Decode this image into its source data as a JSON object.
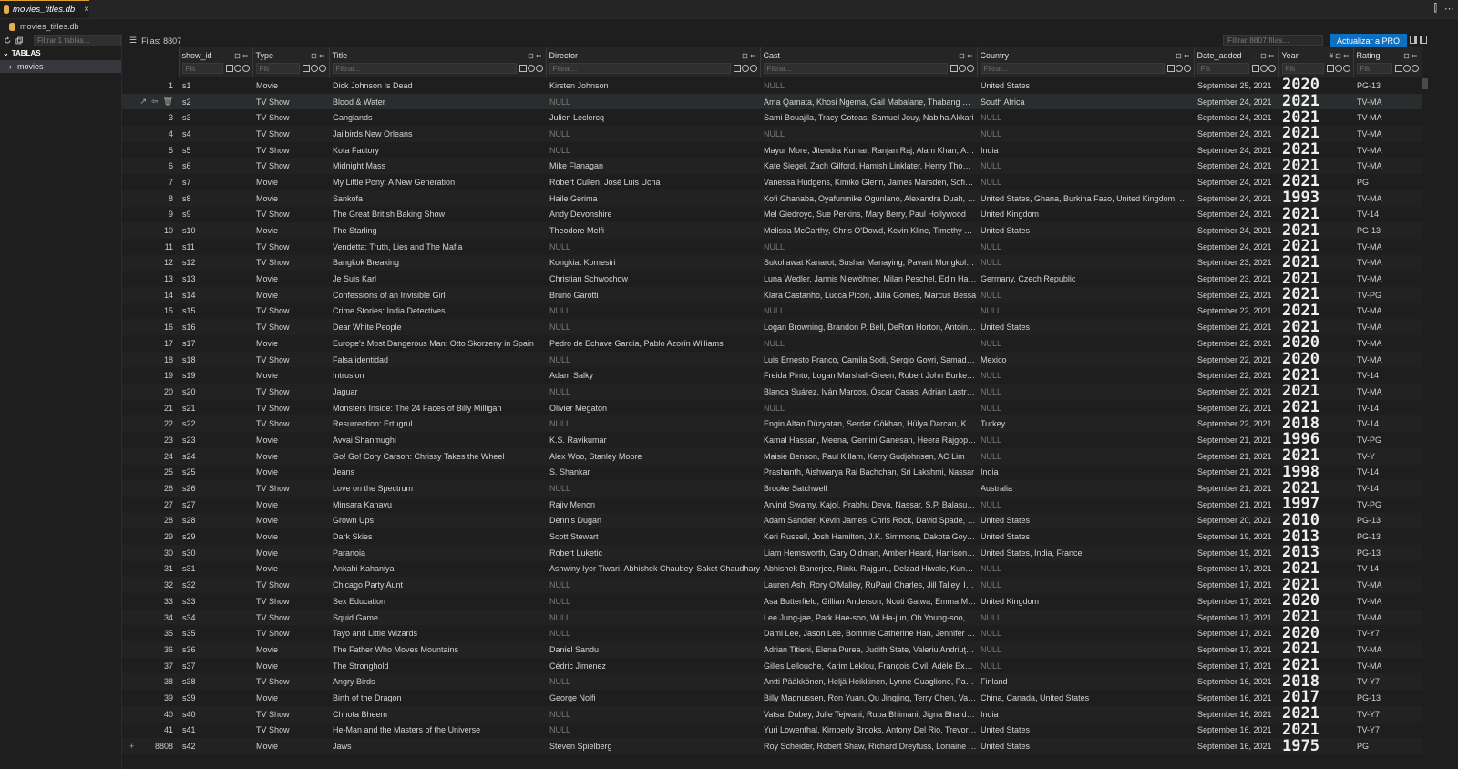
{
  "tab": {
    "title": "movies_titles.db",
    "close": "×",
    "right_icons": [
      "⫿",
      "⋯"
    ]
  },
  "breadcrumb": {
    "file": "movies_titles.db"
  },
  "sidebar": {
    "filter_placeholder": "Filtrar 1 tablas...",
    "section": "TABLAS",
    "item": "movies"
  },
  "toolbar": {
    "rows_label": "Filas: 8807",
    "filter_placeholder": "Filtrar 8807 filas...",
    "pro_button": "Actualizar a PRO"
  },
  "columns": [
    {
      "key": "show_id",
      "label": "show_id",
      "filter": "Filt"
    },
    {
      "key": "type",
      "label": "Type",
      "filter": "Filt"
    },
    {
      "key": "title",
      "label": "Title",
      "filter": "Filtrar..."
    },
    {
      "key": "director",
      "label": "Director",
      "filter": "Filtrar..."
    },
    {
      "key": "cast",
      "label": "Cast",
      "filter": "Filtrar..."
    },
    {
      "key": "country",
      "label": "Country",
      "filter": "Filtrar..."
    },
    {
      "key": "date_added",
      "label": "Date_added",
      "filter": "Filt"
    },
    {
      "key": "year",
      "label": "Year",
      "filter": "Filt",
      "type_glyph": "#"
    },
    {
      "key": "rating",
      "label": "Rating",
      "filter": "Filt"
    }
  ],
  "rows": [
    {
      "n": "1",
      "show_id": "s1",
      "type": "Movie",
      "title": "Dick Johnson Is Dead",
      "director": "Kirsten Johnson",
      "cast": "NULL",
      "country": "United States",
      "date_added": "September 25, 2021",
      "year": "2020",
      "rating": "PG-13"
    },
    {
      "n": "",
      "show_id": "s2",
      "type": "TV Show",
      "title": "Blood & Water",
      "director": "NULL",
      "cast": "Ama Qamata, Khosi Ngema, Gail Mabalane, Thabang Molaba, Dillon Windvogel",
      "country": "South Africa",
      "date_added": "September 24, 2021",
      "year": "2021",
      "rating": "TV-MA"
    },
    {
      "n": "3",
      "show_id": "s3",
      "type": "TV Show",
      "title": "Ganglands",
      "director": "Julien Leclercq",
      "cast": "Sami Bouajila, Tracy Gotoas, Samuel Jouy, Nabiha Akkari",
      "country": "NULL",
      "date_added": "September 24, 2021",
      "year": "2021",
      "rating": "TV-MA"
    },
    {
      "n": "4",
      "show_id": "s4",
      "type": "TV Show",
      "title": "Jailbirds New Orleans",
      "director": "NULL",
      "cast": "NULL",
      "country": "NULL",
      "date_added": "September 24, 2021",
      "year": "2021",
      "rating": "TV-MA"
    },
    {
      "n": "5",
      "show_id": "s5",
      "type": "TV Show",
      "title": "Kota Factory",
      "director": "NULL",
      "cast": "Mayur More, Jitendra Kumar, Ranjan Raj, Alam Khan, Ahsaas Channa",
      "country": "India",
      "date_added": "September 24, 2021",
      "year": "2021",
      "rating": "TV-MA"
    },
    {
      "n": "6",
      "show_id": "s6",
      "type": "TV Show",
      "title": "Midnight Mass",
      "director": "Mike Flanagan",
      "cast": "Kate Siegel, Zach Gilford, Hamish Linklater, Henry Thomas",
      "country": "NULL",
      "date_added": "September 24, 2021",
      "year": "2021",
      "rating": "TV-MA"
    },
    {
      "n": "7",
      "show_id": "s7",
      "type": "Movie",
      "title": "My Little Pony: A New Generation",
      "director": "Robert Cullen, José Luis Ucha",
      "cast": "Vanessa Hudgens, Kimiko Glenn, James Marsden, Sofia Carson",
      "country": "NULL",
      "date_added": "September 24, 2021",
      "year": "2021",
      "rating": "PG"
    },
    {
      "n": "8",
      "show_id": "s8",
      "type": "Movie",
      "title": "Sankofa",
      "director": "Haile Gerima",
      "cast": "Kofi Ghanaba, Oyafunmike Ogunlano, Alexandra Duah, Nick Medley",
      "country": "United States, Ghana, Burkina Faso, United Kingdom, Germany",
      "date_added": "September 24, 2021",
      "year": "1993",
      "rating": "TV-MA"
    },
    {
      "n": "9",
      "show_id": "s9",
      "type": "TV Show",
      "title": "The Great British Baking Show",
      "director": "Andy Devonshire",
      "cast": "Mel Giedroyc, Sue Perkins, Mary Berry, Paul Hollywood",
      "country": "United Kingdom",
      "date_added": "September 24, 2021",
      "year": "2021",
      "rating": "TV-14"
    },
    {
      "n": "10",
      "show_id": "s10",
      "type": "Movie",
      "title": "The Starling",
      "director": "Theodore Melfi",
      "cast": "Melissa McCarthy, Chris O'Dowd, Kevin Kline, Timothy Olyphant",
      "country": "United States",
      "date_added": "September 24, 2021",
      "year": "2021",
      "rating": "PG-13"
    },
    {
      "n": "11",
      "show_id": "s11",
      "type": "TV Show",
      "title": "Vendetta: Truth, Lies and The Mafia",
      "director": "NULL",
      "cast": "NULL",
      "country": "NULL",
      "date_added": "September 24, 2021",
      "year": "2021",
      "rating": "TV-MA"
    },
    {
      "n": "12",
      "show_id": "s12",
      "type": "TV Show",
      "title": "Bangkok Breaking",
      "director": "Kongkiat Komesiri",
      "cast": "Sukollawat Kanarot, Sushar Manaying, Pavarit Mongkolpisit",
      "country": "NULL",
      "date_added": "September 23, 2021",
      "year": "2021",
      "rating": "TV-MA"
    },
    {
      "n": "13",
      "show_id": "s13",
      "type": "Movie",
      "title": "Je Suis Karl",
      "director": "Christian Schwochow",
      "cast": "Luna Wedler, Jannis Niewöhner, Milan Peschel, Edin Hasanović",
      "country": "Germany, Czech Republic",
      "date_added": "September 23, 2021",
      "year": "2021",
      "rating": "TV-MA"
    },
    {
      "n": "14",
      "show_id": "s14",
      "type": "Movie",
      "title": "Confessions of an Invisible Girl",
      "director": "Bruno Garotti",
      "cast": "Klara Castanho, Lucca Picon, Júlia Gomes, Marcus Bessa",
      "country": "NULL",
      "date_added": "September 22, 2021",
      "year": "2021",
      "rating": "TV-PG"
    },
    {
      "n": "15",
      "show_id": "s15",
      "type": "TV Show",
      "title": "Crime Stories: India Detectives",
      "director": "NULL",
      "cast": "NULL",
      "country": "NULL",
      "date_added": "September 22, 2021",
      "year": "2021",
      "rating": "TV-MA"
    },
    {
      "n": "16",
      "show_id": "s16",
      "type": "TV Show",
      "title": "Dear White People",
      "director": "NULL",
      "cast": "Logan Browning, Brandon P. Bell, DeRon Horton, Antoinette Robertson",
      "country": "United States",
      "date_added": "September 22, 2021",
      "year": "2021",
      "rating": "TV-MA"
    },
    {
      "n": "17",
      "show_id": "s17",
      "type": "Movie",
      "title": "Europe's Most Dangerous Man: Otto Skorzeny in Spain",
      "director": "Pedro de Echave García, Pablo Azorín Williams",
      "cast": "NULL",
      "country": "NULL",
      "date_added": "September 22, 2021",
      "year": "2020",
      "rating": "TV-MA"
    },
    {
      "n": "18",
      "show_id": "s18",
      "type": "TV Show",
      "title": "Falsa identidad",
      "director": "NULL",
      "cast": "Luis Ernesto Franco, Camila Sodi, Sergio Goyri, Samadhi Zendejas",
      "country": "Mexico",
      "date_added": "September 22, 2021",
      "year": "2020",
      "rating": "TV-MA"
    },
    {
      "n": "19",
      "show_id": "s19",
      "type": "Movie",
      "title": "Intrusion",
      "director": "Adam Salky",
      "cast": "Freida Pinto, Logan Marshall-Green, Robert John Burke, Megan Elisabeth Kelly",
      "country": "NULL",
      "date_added": "September 22, 2021",
      "year": "2021",
      "rating": "TV-14"
    },
    {
      "n": "20",
      "show_id": "s20",
      "type": "TV Show",
      "title": "Jaguar",
      "director": "NULL",
      "cast": "Blanca Suárez, Iván Marcos, Óscar Casas, Adrián Lastra, Francesc Garrido",
      "country": "NULL",
      "date_added": "September 22, 2021",
      "year": "2021",
      "rating": "TV-MA"
    },
    {
      "n": "21",
      "show_id": "s21",
      "type": "TV Show",
      "title": "Monsters Inside: The 24 Faces of Billy Milligan",
      "director": "Olivier Megaton",
      "cast": "NULL",
      "country": "NULL",
      "date_added": "September 22, 2021",
      "year": "2021",
      "rating": "TV-14"
    },
    {
      "n": "22",
      "show_id": "s22",
      "type": "TV Show",
      "title": "Resurrection: Ertugrul",
      "director": "NULL",
      "cast": "Engin Altan Düzyatan, Serdar Gökhan, Hülya Darcan, Kaan Taşaner",
      "country": "Turkey",
      "date_added": "September 22, 2021",
      "year": "2018",
      "rating": "TV-14"
    },
    {
      "n": "23",
      "show_id": "s23",
      "type": "Movie",
      "title": "Avvai Shanmughi",
      "director": "K.S. Ravikumar",
      "cast": "Kamal Hassan, Meena, Gemini Ganesan, Heera Rajgopal, Nassar",
      "country": "NULL",
      "date_added": "September 21, 2021",
      "year": "1996",
      "rating": "TV-PG"
    },
    {
      "n": "24",
      "show_id": "s24",
      "type": "Movie",
      "title": "Go! Go! Cory Carson: Chrissy Takes the Wheel",
      "director": "Alex Woo, Stanley Moore",
      "cast": "Maisie Benson, Paul Killam, Kerry Gudjohnsen, AC Lim",
      "country": "NULL",
      "date_added": "September 21, 2021",
      "year": "2021",
      "rating": "TV-Y"
    },
    {
      "n": "25",
      "show_id": "s25",
      "type": "Movie",
      "title": "Jeans",
      "director": "S. Shankar",
      "cast": "Prashanth, Aishwarya Rai Bachchan, Sri Lakshmi, Nassar",
      "country": "India",
      "date_added": "September 21, 2021",
      "year": "1998",
      "rating": "TV-14"
    },
    {
      "n": "26",
      "show_id": "s26",
      "type": "TV Show",
      "title": "Love on the Spectrum",
      "director": "NULL",
      "cast": "Brooke Satchwell",
      "country": "Australia",
      "date_added": "September 21, 2021",
      "year": "2021",
      "rating": "TV-14"
    },
    {
      "n": "27",
      "show_id": "s27",
      "type": "Movie",
      "title": "Minsara Kanavu",
      "director": "Rajiv Menon",
      "cast": "Arvind Swamy, Kajol, Prabhu Deva, Nassar, S.P. Balasubrahmanyam",
      "country": "NULL",
      "date_added": "September 21, 2021",
      "year": "1997",
      "rating": "TV-PG"
    },
    {
      "n": "28",
      "show_id": "s28",
      "type": "Movie",
      "title": "Grown Ups",
      "director": "Dennis Dugan",
      "cast": "Adam Sandler, Kevin James, Chris Rock, David Spade, Rob Schneider",
      "country": "United States",
      "date_added": "September 20, 2021",
      "year": "2010",
      "rating": "PG-13"
    },
    {
      "n": "29",
      "show_id": "s29",
      "type": "Movie",
      "title": "Dark Skies",
      "director": "Scott Stewart",
      "cast": "Keri Russell, Josh Hamilton, J.K. Simmons, Dakota Goyo, Kadan Rockett",
      "country": "United States",
      "date_added": "September 19, 2021",
      "year": "2013",
      "rating": "PG-13"
    },
    {
      "n": "30",
      "show_id": "s30",
      "type": "Movie",
      "title": "Paranoia",
      "director": "Robert Luketic",
      "cast": "Liam Hemsworth, Gary Oldman, Amber Heard, Harrison Ford",
      "country": "United States, India, France",
      "date_added": "September 19, 2021",
      "year": "2013",
      "rating": "PG-13"
    },
    {
      "n": "31",
      "show_id": "s31",
      "type": "Movie",
      "title": "Ankahi Kahaniya",
      "director": "Ashwiny Iyer Tiwari, Abhishek Chaubey, Saket Chaudhary",
      "cast": "Abhishek Banerjee, Rinku Rajguru, Delzad Hiwale, Kunal Kapoor",
      "country": "NULL",
      "date_added": "September 17, 2021",
      "year": "2021",
      "rating": "TV-14"
    },
    {
      "n": "32",
      "show_id": "s32",
      "type": "TV Show",
      "title": "Chicago Party Aunt",
      "director": "NULL",
      "cast": "Lauren Ash, Rory O'Malley, RuPaul Charles, Jill Talley, Ike Barinholtz",
      "country": "NULL",
      "date_added": "September 17, 2021",
      "year": "2021",
      "rating": "TV-MA"
    },
    {
      "n": "33",
      "show_id": "s33",
      "type": "TV Show",
      "title": "Sex Education",
      "director": "NULL",
      "cast": "Asa Butterfield, Gillian Anderson, Ncuti Gatwa, Emma Mackey",
      "country": "United Kingdom",
      "date_added": "September 17, 2021",
      "year": "2020",
      "rating": "TV-MA"
    },
    {
      "n": "34",
      "show_id": "s34",
      "type": "TV Show",
      "title": "Squid Game",
      "director": "NULL",
      "cast": "Lee Jung-jae, Park Hae-soo, Wi Ha-jun, Oh Young-soo, Jung Ho-yeon",
      "country": "NULL",
      "date_added": "September 17, 2021",
      "year": "2021",
      "rating": "TV-MA"
    },
    {
      "n": "35",
      "show_id": "s35",
      "type": "TV Show",
      "title": "Tayo and Little Wizards",
      "director": "NULL",
      "cast": "Dami Lee, Jason Lee, Bommie Catherine Han, Jennifer Waescher",
      "country": "NULL",
      "date_added": "September 17, 2021",
      "year": "2020",
      "rating": "TV-Y7"
    },
    {
      "n": "36",
      "show_id": "s36",
      "type": "Movie",
      "title": "The Father Who Moves Mountains",
      "director": "Daniel Sandu",
      "cast": "Adrian Titieni, Elena Purea, Judith State, Valeriu Andriuţă, Tudor Smoleanu",
      "country": "NULL",
      "date_added": "September 17, 2021",
      "year": "2021",
      "rating": "TV-MA"
    },
    {
      "n": "37",
      "show_id": "s37",
      "type": "Movie",
      "title": "The Stronghold",
      "director": "Cédric Jimenez",
      "cast": "Gilles Lellouche, Karim Leklou, François Civil, Adèle Exarchopoulos",
      "country": "NULL",
      "date_added": "September 17, 2021",
      "year": "2021",
      "rating": "TV-MA"
    },
    {
      "n": "38",
      "show_id": "s38",
      "type": "TV Show",
      "title": "Angry Birds",
      "director": "NULL",
      "cast": "Antti Pääkkönen, Heljä Heikkinen, Lynne Guaglione, Pasi Ruohonen",
      "country": "Finland",
      "date_added": "September 16, 2021",
      "year": "2018",
      "rating": "TV-Y7"
    },
    {
      "n": "39",
      "show_id": "s39",
      "type": "Movie",
      "title": "Birth of the Dragon",
      "director": "George Nolfi",
      "cast": "Billy Magnussen, Ron Yuan, Qu Jingjing, Terry Chen, Vanness Wu",
      "country": "China, Canada, United States",
      "date_added": "September 16, 2021",
      "year": "2017",
      "rating": "PG-13"
    },
    {
      "n": "40",
      "show_id": "s40",
      "type": "TV Show",
      "title": "Chhota Bheem",
      "director": "NULL",
      "cast": "Vatsal Dubey, Julie Tejwani, Rupa Bhimani, Jigna Bhardwaj",
      "country": "India",
      "date_added": "September 16, 2021",
      "year": "2021",
      "rating": "TV-Y7"
    },
    {
      "n": "41",
      "show_id": "s41",
      "type": "TV Show",
      "title": "He-Man and the Masters of the Universe",
      "director": "NULL",
      "cast": "Yuri Lowenthal, Kimberly Brooks, Antony Del Rio, Trevor Devall",
      "country": "United States",
      "date_added": "September 16, 2021",
      "year": "2021",
      "rating": "TV-Y7"
    },
    {
      "n": "8808",
      "show_id": "s42",
      "type": "Movie",
      "title": "Jaws",
      "director": "Steven Spielberg",
      "cast": "Roy Scheider, Robert Shaw, Richard Dreyfuss, Lorraine Gary",
      "country": "United States",
      "date_added": "September 16, 2021",
      "year": "1975",
      "rating": "PG"
    }
  ],
  "colors": {
    "accent": "#0e70c0",
    "tab_border": "#e0a030",
    "null_text": "#7a7a7a"
  }
}
